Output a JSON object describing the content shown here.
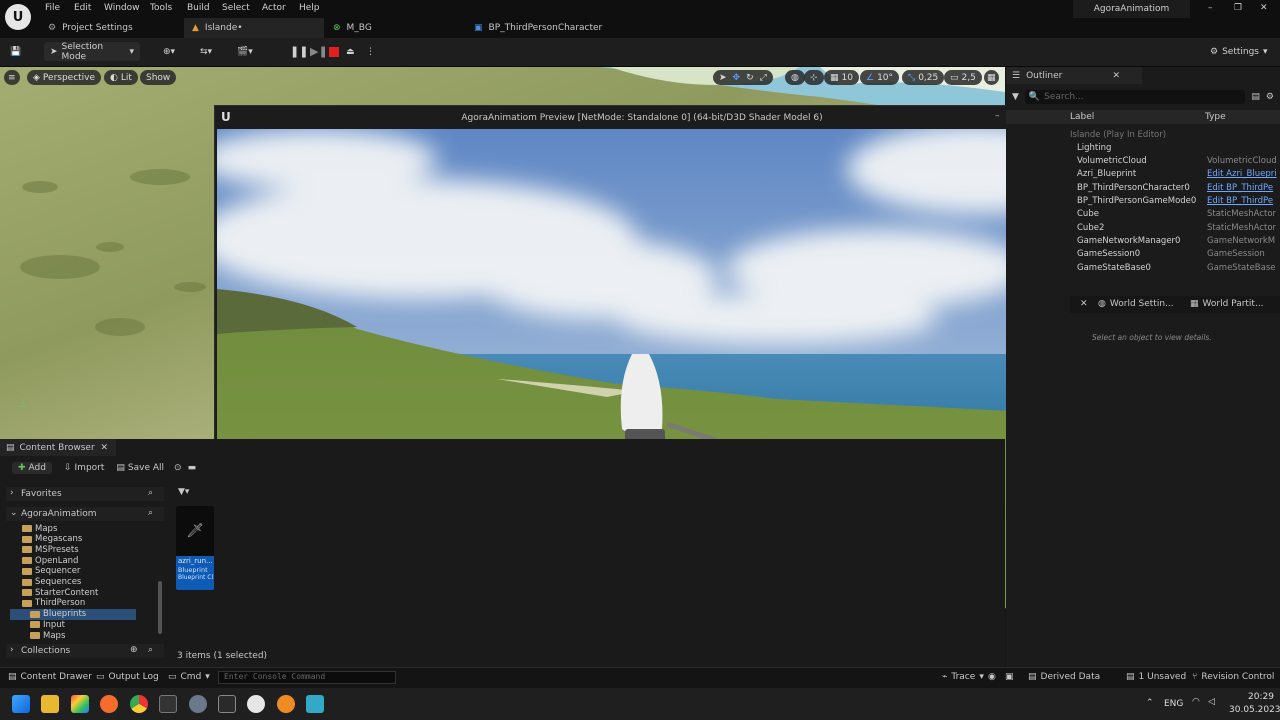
{
  "menu": {
    "items": [
      "File",
      "Edit",
      "Window",
      "Tools",
      "Build",
      "Select",
      "Actor",
      "Help"
    ],
    "project_name": "AgoraAnimatiom"
  },
  "tabs": [
    {
      "label": "Project Settings"
    },
    {
      "label": "Islande•"
    },
    {
      "label": "M_BG"
    },
    {
      "label": "BP_ThirdPersonCharacter"
    }
  ],
  "toolbar": {
    "selection_mode": "Selection Mode",
    "settings": "Settings"
  },
  "viewport": {
    "perspective": "Perspective",
    "lit": "Lit",
    "show": "Show",
    "grid_snap": "10",
    "rot_snap": "10°",
    "scale_snap": "0,25",
    "cam_speed": "2,5"
  },
  "preview": {
    "title": "AgoraAnimatiom Preview [NetMode: Standalone 0]  (64-bit/D3D Shader Model 6)"
  },
  "outliner": {
    "title": "Outliner",
    "search_placeholder": "Search...",
    "col_label": "Label",
    "col_type": "Type",
    "rows": [
      {
        "label": "Islande (Play In Editor)",
        "type": ""
      },
      {
        "label": "Lighting",
        "type": ""
      },
      {
        "label": "VolumetricCloud",
        "type": "VolumetricCloud"
      },
      {
        "label": "Azri_Blueprint",
        "type": "Edit Azri_Bluepri"
      },
      {
        "label": "BP_ThirdPersonCharacter0",
        "type": "Edit BP_ThirdPe"
      },
      {
        "label": "BP_ThirdPersonGameMode0",
        "type": "Edit BP_ThirdPe"
      },
      {
        "label": "Cube",
        "type": "StaticMeshActor"
      },
      {
        "label": "Cube2",
        "type": "StaticMeshActor"
      },
      {
        "label": "GameNetworkManager0",
        "type": "GameNetworkM"
      },
      {
        "label": "GameSession0",
        "type": "GameSession"
      },
      {
        "label": "GameStateBase0",
        "type": "GameStateBase"
      }
    ],
    "details_tabs": [
      "World Settin...",
      "World Partit..."
    ],
    "details_empty": "Select an object to view details."
  },
  "content_browser": {
    "title": "Content Browser",
    "add": "Add",
    "import": "Import",
    "save_all": "Save All",
    "favorites": "Favorites",
    "root": "AgoraAnimatiom",
    "folders": [
      {
        "label": "Maps",
        "indent": 1,
        "selected": false
      },
      {
        "label": "Megascans",
        "indent": 1,
        "selected": false
      },
      {
        "label": "MSPresets",
        "indent": 1,
        "selected": false
      },
      {
        "label": "OpenLand",
        "indent": 1,
        "selected": false
      },
      {
        "label": "Sequencer",
        "indent": 1,
        "selected": false
      },
      {
        "label": "Sequences",
        "indent": 1,
        "selected": false
      },
      {
        "label": "StarterContent",
        "indent": 1,
        "selected": false
      },
      {
        "label": "ThirdPerson",
        "indent": 1,
        "selected": false
      },
      {
        "label": "Blueprints",
        "indent": 2,
        "selected": true
      },
      {
        "label": "Input",
        "indent": 2,
        "selected": false
      },
      {
        "label": "Maps",
        "indent": 2,
        "selected": false
      }
    ],
    "collections": "Collections",
    "asset_name": "azri_run...",
    "asset_type": "Blueprint",
    "asset_class": "Blueprint Cl...",
    "items_count": "3 items (1 selected)"
  },
  "statusbar": {
    "content_drawer": "Content Drawer",
    "output_log": "Output Log",
    "cmd": "Cmd",
    "console_placeholder": "Enter Console Command",
    "trace": "Trace",
    "derived_data": "Derived Data",
    "unsaved": "1 Unsaved",
    "revision_control": "Revision Control"
  },
  "taskbar": {
    "lang": "ENG",
    "time": "20:29",
    "date": "30.05.2023"
  },
  "colors": {
    "accent": "#0070e0",
    "selection": "#0e5bb5",
    "record_red": "#e02020"
  }
}
